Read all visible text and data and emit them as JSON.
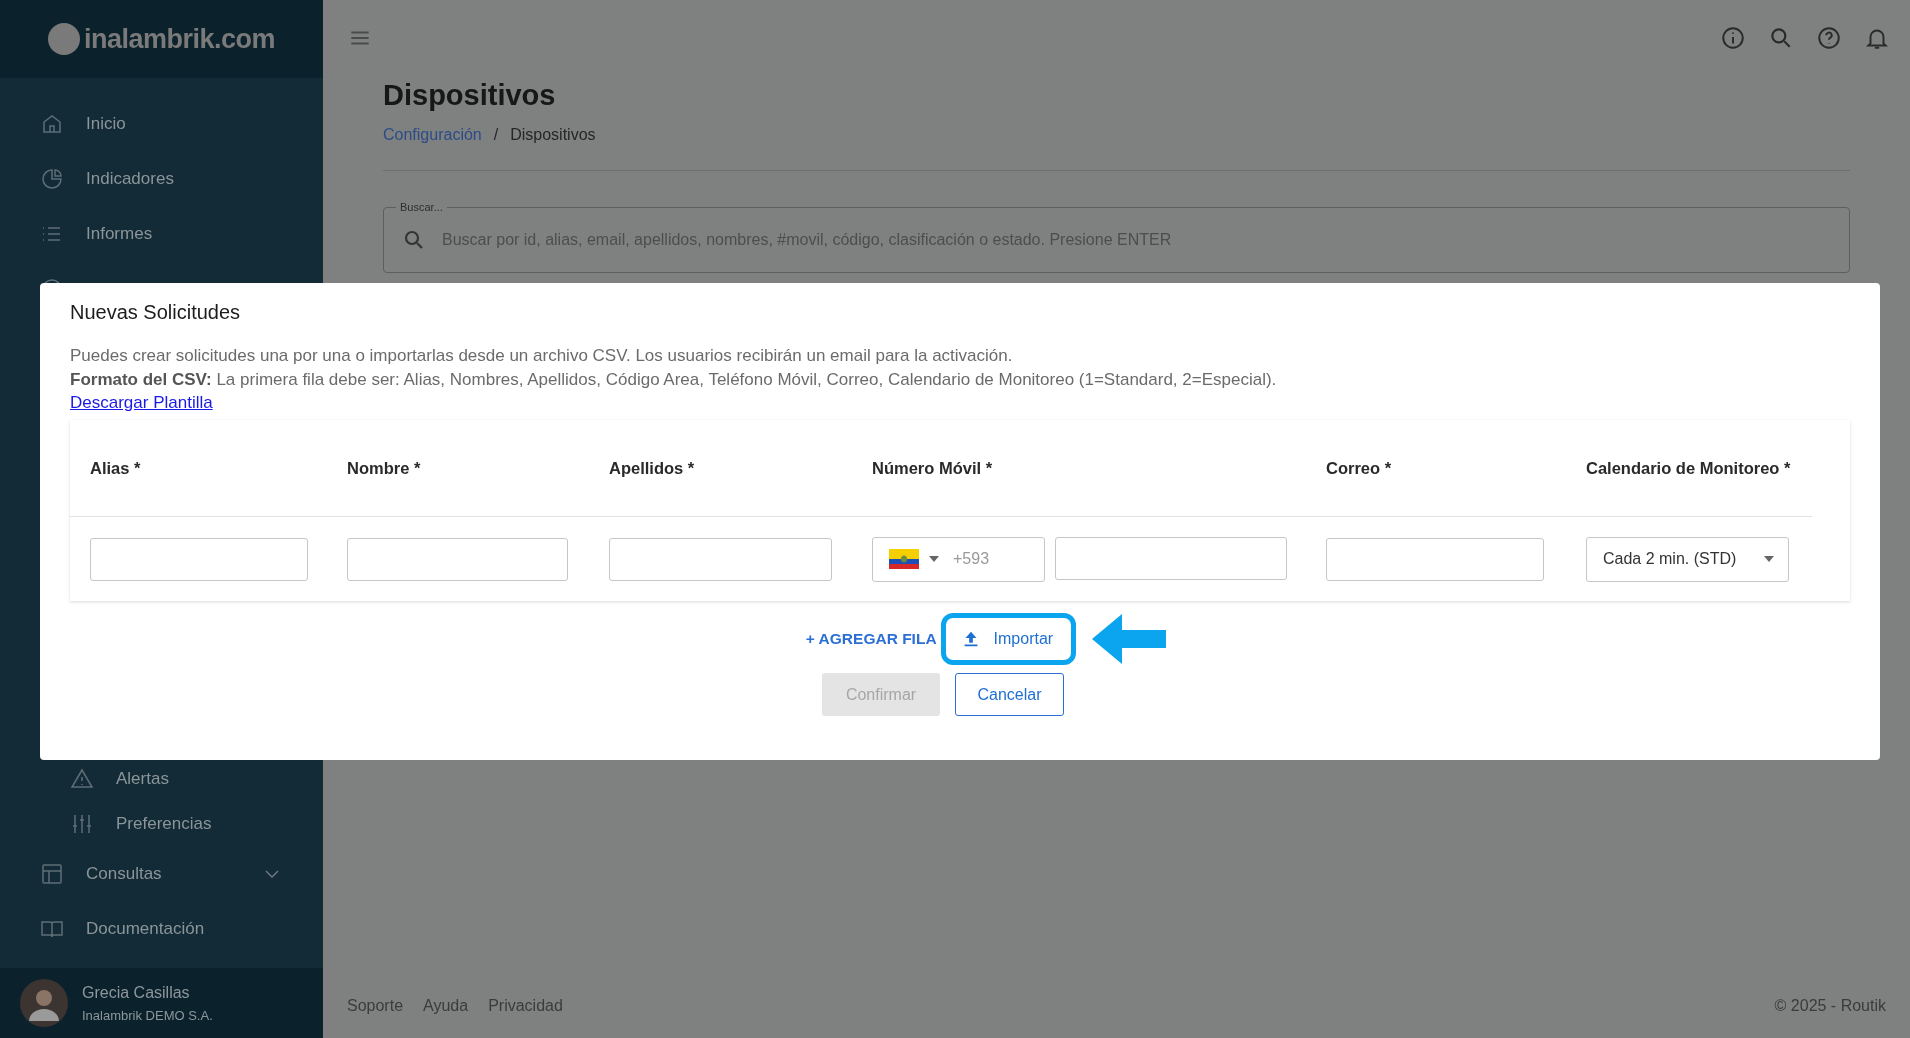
{
  "sidebar": {
    "logo": "inalambrik.com",
    "top_items": [
      {
        "label": "Inicio"
      },
      {
        "label": "Indicadores"
      },
      {
        "label": "Informes"
      }
    ],
    "bottom_items": [
      {
        "label": "Alertas",
        "sub": true,
        "expandable": false
      },
      {
        "label": "Preferencias",
        "sub": true,
        "expandable": false
      },
      {
        "label": "Consultas",
        "sub": false,
        "expandable": true
      },
      {
        "label": "Documentación",
        "sub": false,
        "expandable": false
      }
    ],
    "user": {
      "name": "Grecia Casillas",
      "company": "Inalambrik DEMO S.A."
    }
  },
  "page": {
    "title": "Dispositivos",
    "breadcrumb_separator": "/",
    "breadcrumb": [
      {
        "label": "Configuración",
        "link": true
      },
      {
        "label": "Dispositivos",
        "link": false
      }
    ],
    "search": {
      "label": "Buscar...",
      "placeholder": "Buscar por id, alias, email, apellidos, nombres, #movil, código, clasificación o estado. Presione ENTER"
    }
  },
  "footer": {
    "links": [
      "Soporte",
      "Ayuda",
      "Privacidad"
    ],
    "copyright": "© 2025 - Routik"
  },
  "dialog": {
    "title": "Nuevas Solicitudes",
    "description": "Puedes crear solicitudes una por una o importarlas desde un archivo CSV. Los usuarios recibirán un email para la activación.",
    "format": "**Formato del CSV:** La primera fila debe ser: Alias, Nombres, Apellidos, Código Area, Teléfono Móvil, Correo, Calendario de Monitoreo (1=Standard, 2=Especial).",
    "template_link": "Descargar Plantilla",
    "columns": [
      {
        "label": "Alias *",
        "kind": "text"
      },
      {
        "label": "Nombre *",
        "kind": "text"
      },
      {
        "label": "Apellidos *",
        "kind": "text"
      },
      {
        "label": "Número Móvil *",
        "kind": "phone",
        "prefix": "+593"
      },
      {
        "label": "Correo *",
        "kind": "text"
      },
      {
        "label": "Calendario de Monitoreo *",
        "kind": "select",
        "value": "Cada 2 min. (STD)"
      }
    ],
    "add_row": "+ AGREGAR FILA",
    "import": "Importar",
    "import_highlighted": true,
    "confirm": {
      "label": "Confirmar",
      "disabled": true
    },
    "cancel": "Cancelar"
  }
}
